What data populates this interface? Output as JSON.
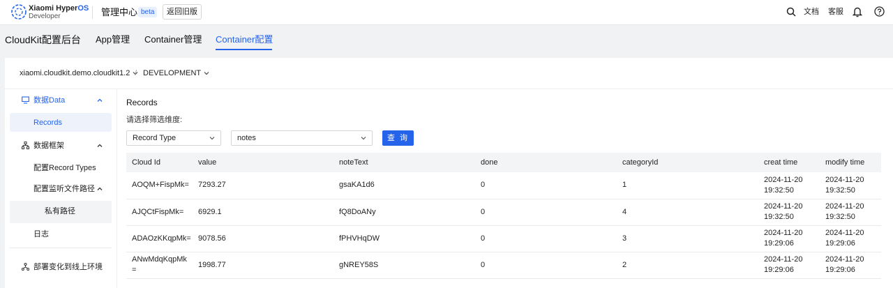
{
  "header": {
    "brand_line1_prefix": "Xiaomi Hyper",
    "brand_line1_os": "OS",
    "brand_line2": "Developer",
    "console_title": "管理中心",
    "beta_badge": "beta",
    "back_button": "返回旧版",
    "docs_link": "文档",
    "support_link": "客服"
  },
  "section_nav": {
    "title": "CloudKit配置后台",
    "tabs": [
      {
        "label": "App管理",
        "active": false
      },
      {
        "label": "Container管理",
        "active": false
      },
      {
        "label": "Container配置",
        "active": true
      }
    ]
  },
  "breadcrumb": {
    "container": "xiaomi.cloudkit.demo.cloudkit1.2",
    "separator": "/",
    "environment": "DEVELOPMENT"
  },
  "sidebar": {
    "data_group": "数据Data",
    "records": "Records",
    "schema_group": "数据框架",
    "record_types": "配置Record Types",
    "watch_paths": "配置监听文件路径",
    "private_path": "私有路径",
    "logs": "日志",
    "deploy": "部署变化到线上环境"
  },
  "content": {
    "title": "Records",
    "filter_label": "请选择筛选维度:",
    "filter_dimension": "Record Type",
    "filter_value": "notes",
    "query_button": "查 询"
  },
  "table": {
    "columns": [
      "Cloud Id",
      "value",
      "noteText",
      "done",
      "categoryId",
      "creat time",
      "modify time"
    ],
    "rows": [
      {
        "cloud_id": "AOQM+FispMk=",
        "value": "7293.27",
        "note": "gsaKA1d6",
        "done": "0",
        "category": "1",
        "creat_date": "2024-11-20",
        "creat_time": "19:32:50",
        "modify_date": "2024-11-20",
        "modify_time": "19:32:50"
      },
      {
        "cloud_id": "AJQCtFispMk=",
        "value": "6929.1",
        "note": "fQ8DoANy",
        "done": "0",
        "category": "4",
        "creat_date": "2024-11-20",
        "creat_time": "19:32:50",
        "modify_date": "2024-11-20",
        "modify_time": "19:32:50"
      },
      {
        "cloud_id": "ADAOzKKqpMk=",
        "value": "9078.56",
        "note": "fPHVHqDW",
        "done": "0",
        "category": "3",
        "creat_date": "2024-11-20",
        "creat_time": "19:29:06",
        "modify_date": "2024-11-20",
        "modify_time": "19:29:06"
      },
      {
        "cloud_id": "ANwMdqKqpMk=",
        "value": "1998.77",
        "note": "gNREY58S",
        "done": "0",
        "category": "2",
        "creat_date": "2024-11-20",
        "creat_time": "19:29:06",
        "modify_date": "2024-11-20",
        "modify_time": "19:29:06"
      }
    ]
  },
  "colors": {
    "accent": "#2563eb",
    "selected_bg": "#eef2fb",
    "page_bg": "#f1f2f4"
  }
}
